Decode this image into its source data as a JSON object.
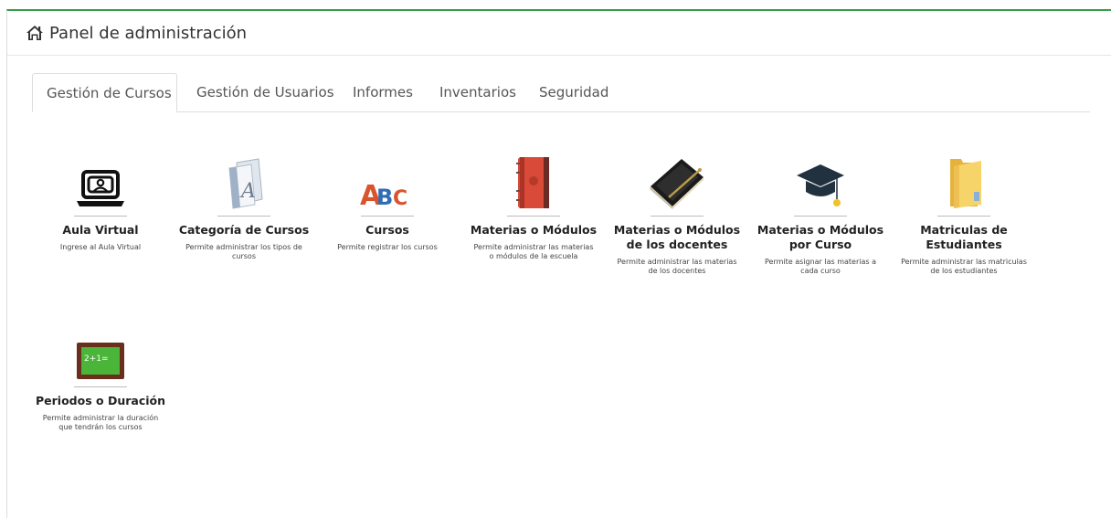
{
  "header": {
    "title": "Panel de administración",
    "icon": "home-icon"
  },
  "tabs": [
    {
      "label": "Gestión de Cursos",
      "active": true
    },
    {
      "label": "Gestión de Usuarios",
      "active": false
    },
    {
      "label": "Informes",
      "active": false
    },
    {
      "label": "Inventarios",
      "active": false
    },
    {
      "label": "Seguridad",
      "active": false
    }
  ],
  "items": [
    {
      "name": "Aula Virtual",
      "desc": "Ingrese al Aula Virtual",
      "icon": "laptop-user-icon"
    },
    {
      "name": "Categoría de Cursos",
      "desc": "Permite administrar los tipos de cursos",
      "icon": "font-document-icon"
    },
    {
      "name": "Cursos",
      "desc": "Permite registrar los cursos",
      "icon": "abc-icon"
    },
    {
      "name": "Materias o Módulos",
      "desc": "Permite administrar las materias o módulos de la escuela",
      "icon": "notebook-icon"
    },
    {
      "name": "Materias o Módulos de los docentes",
      "desc": "Permite administrar las materias de los docentes",
      "icon": "black-book-icon"
    },
    {
      "name": "Materias o Módulos por Curso",
      "desc": "Permite asignar las materias a cada curso",
      "icon": "graduation-cap-icon"
    },
    {
      "name": "Matriculas de Estudiantes",
      "desc": "Permite administrar las matriculas de los estudiantes",
      "icon": "folder-icon"
    },
    {
      "name": "Periodos o Duración",
      "desc": "Permite administrar la duración que tendrán los cursos",
      "icon": "chalkboard-icon"
    }
  ],
  "colors": {
    "accent": "#3a9b4a"
  }
}
